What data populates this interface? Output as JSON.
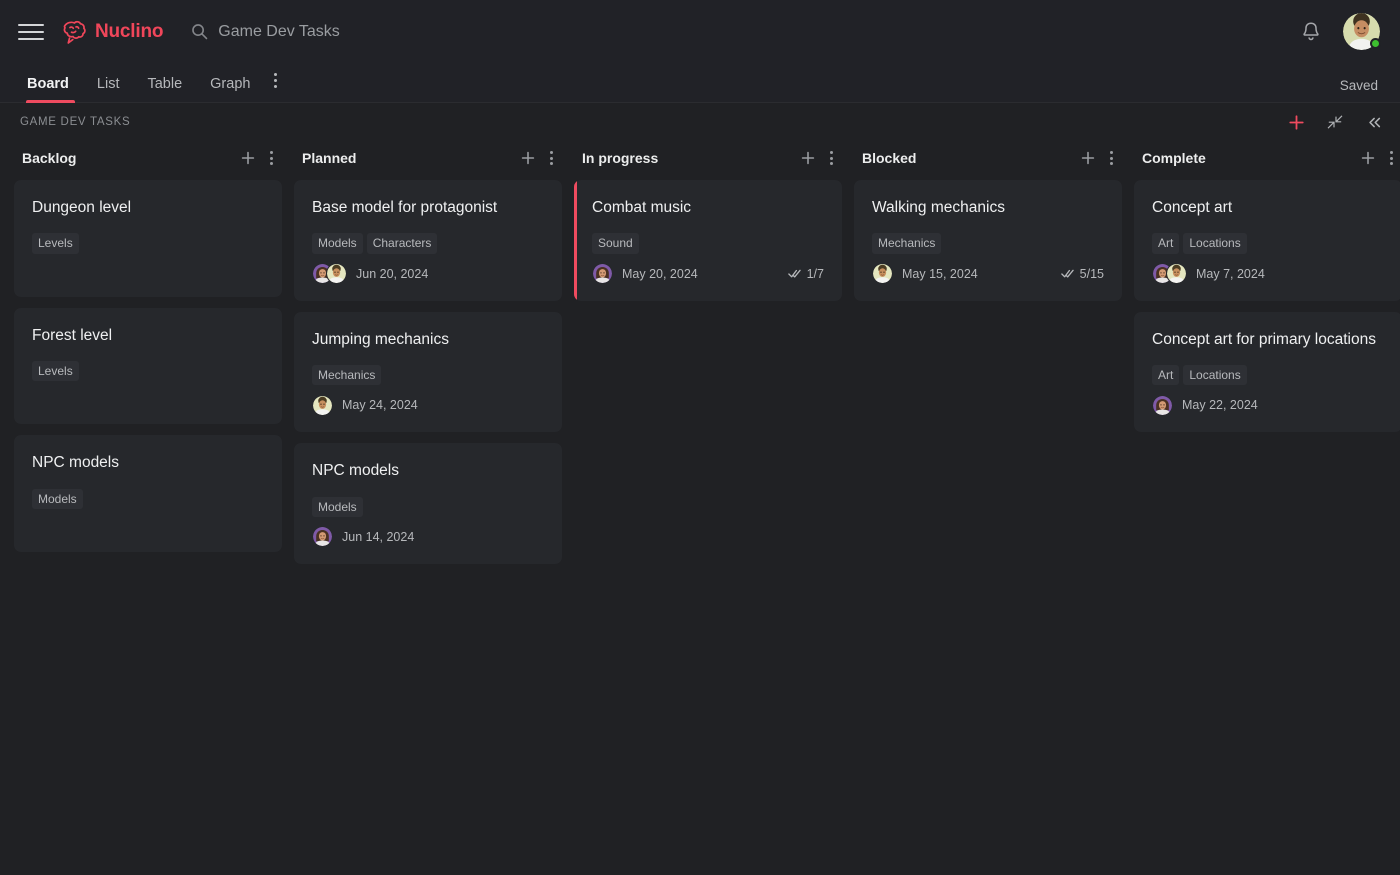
{
  "app": {
    "logo_text": "Nuclino",
    "brand_color": "#f0465a",
    "accent_color": "#ef4b5f",
    "status_dot_color": "#3dbf2f"
  },
  "header": {
    "menu_icon": "hamburger-icon",
    "logo_icon": "nuclino-brain-logo-icon",
    "search_icon": "search-icon",
    "search_value": "Game Dev Tasks",
    "notifications_icon": "bell-icon",
    "avatar_icon": "user-avatar",
    "presence": "online"
  },
  "tabbar": {
    "tabs": [
      {
        "label": "Board",
        "active": true
      },
      {
        "label": "List",
        "active": false
      },
      {
        "label": "Table",
        "active": false
      },
      {
        "label": "Graph",
        "active": false
      }
    ],
    "more_icon": "more-vertical-icon",
    "save_status": "Saved"
  },
  "breadcrumb": {
    "label": "GAME DEV TASKS",
    "actions": [
      {
        "name": "add-item-button",
        "icon": "plus-icon"
      },
      {
        "name": "collapse-columns-button",
        "icon": "collapse-diagonal-icon"
      },
      {
        "name": "collapse-sidebar-button",
        "icon": "chevron-double-left-icon"
      }
    ]
  },
  "board": {
    "columns": [
      {
        "title": "Backlog",
        "add_icon": "plus-icon",
        "more_icon": "more-vertical-icon",
        "cards": [
          {
            "title": "Dungeon level",
            "tags": [
              "Levels"
            ],
            "avatars": [],
            "date": "",
            "progress": "",
            "accent": false
          },
          {
            "title": "Forest level",
            "tags": [
              "Levels"
            ],
            "avatars": [],
            "date": "",
            "progress": "",
            "accent": false
          },
          {
            "title": "NPC models",
            "tags": [
              "Models"
            ],
            "avatars": [],
            "date": "",
            "progress": "",
            "accent": false
          }
        ]
      },
      {
        "title": "Planned",
        "add_icon": "plus-icon",
        "more_icon": "more-vertical-icon",
        "cards": [
          {
            "title": "Base model for protagonist",
            "tags": [
              "Models",
              "Characters"
            ],
            "avatars": [
              "woman-purple",
              "man-beige"
            ],
            "date": "Jun 20, 2024",
            "progress": "",
            "accent": false
          },
          {
            "title": "Jumping mechanics",
            "tags": [
              "Mechanics"
            ],
            "avatars": [
              "man-beige"
            ],
            "date": "May 24, 2024",
            "progress": "",
            "accent": false
          },
          {
            "title": "NPC models",
            "tags": [
              "Models"
            ],
            "avatars": [
              "woman-purple"
            ],
            "date": "Jun 14, 2024",
            "progress": "",
            "accent": false
          }
        ]
      },
      {
        "title": "In progress",
        "add_icon": "plus-icon",
        "more_icon": "more-vertical-icon",
        "cards": [
          {
            "title": "Combat music",
            "tags": [
              "Sound"
            ],
            "avatars": [
              "woman-purple"
            ],
            "date": "May 20, 2024",
            "progress": "1/7",
            "accent": true
          }
        ]
      },
      {
        "title": "Blocked",
        "add_icon": "plus-icon",
        "more_icon": "more-vertical-icon",
        "cards": [
          {
            "title": "Walking mechanics",
            "tags": [
              "Mechanics"
            ],
            "avatars": [
              "man-beige"
            ],
            "date": "May 15, 2024",
            "progress": "5/15",
            "accent": false
          }
        ]
      },
      {
        "title": "Complete",
        "add_icon": "plus-icon",
        "more_icon": "more-vertical-icon",
        "cards": [
          {
            "title": "Concept art",
            "tags": [
              "Art",
              "Locations"
            ],
            "avatars": [
              "woman-purple",
              "man-beige"
            ],
            "date": "May 7, 2024",
            "progress": "",
            "accent": false
          },
          {
            "title": "Concept art for primary locations",
            "tags": [
              "Art",
              "Locations"
            ],
            "avatars": [
              "woman-purple"
            ],
            "date": "May 22, 2024",
            "progress": "",
            "accent": false
          }
        ]
      }
    ]
  }
}
